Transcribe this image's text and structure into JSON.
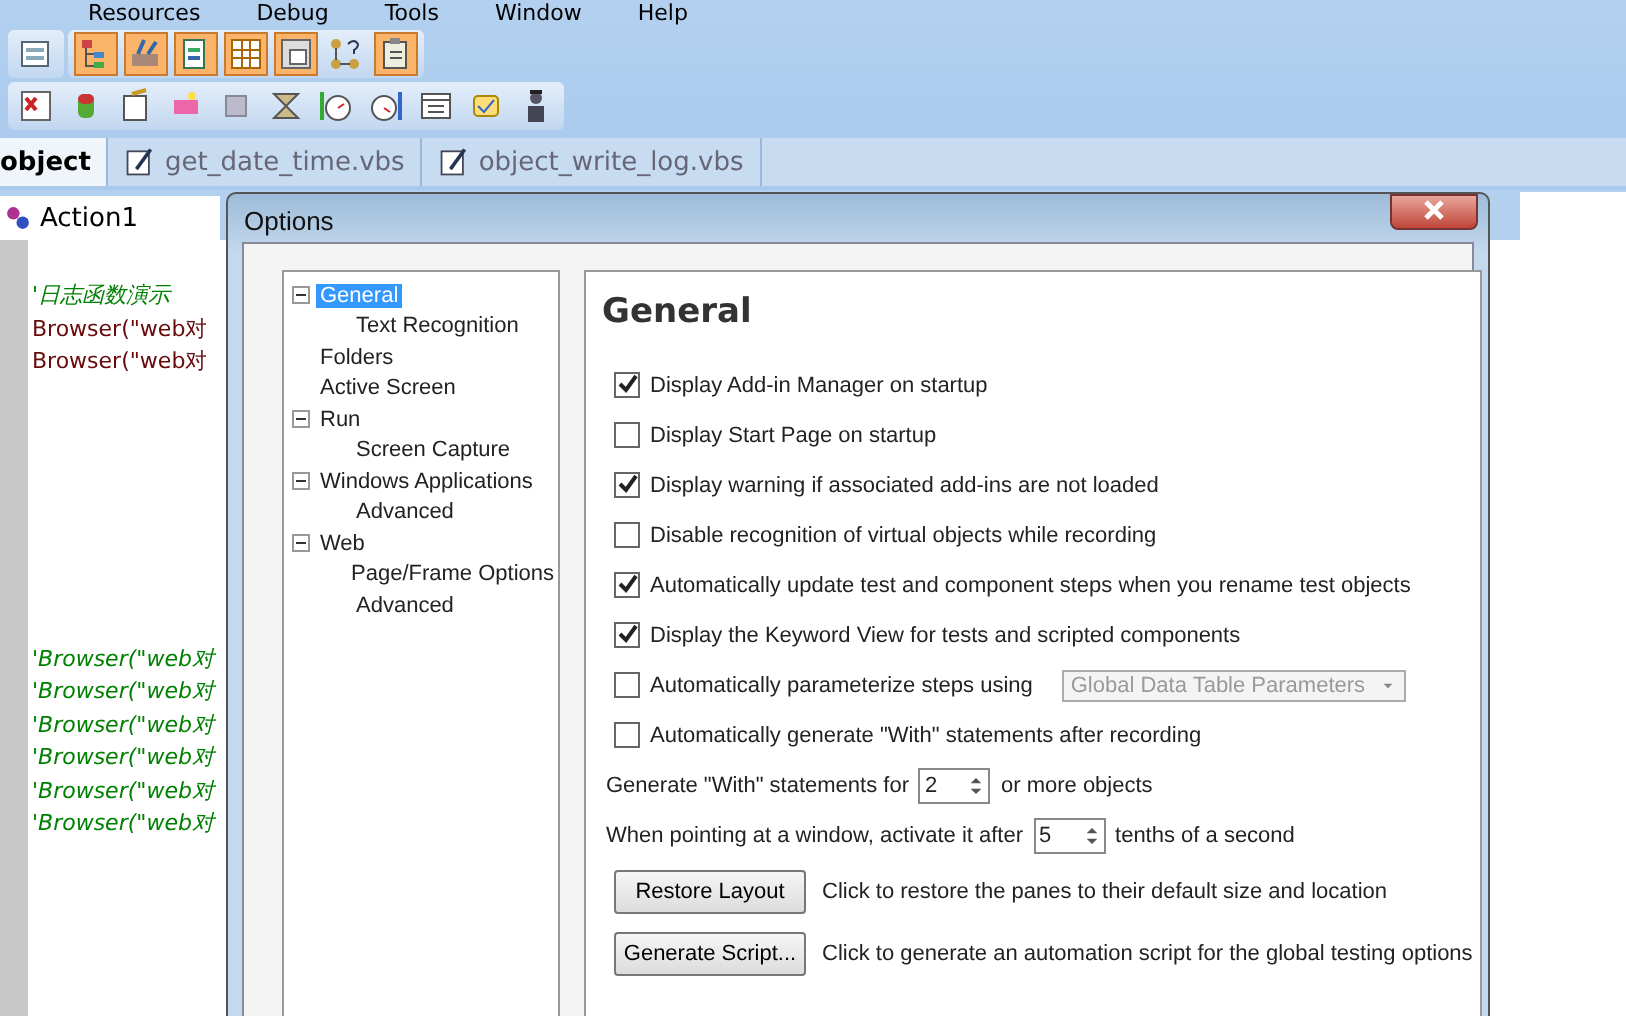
{
  "menu": [
    "Resources",
    "Debug",
    "Tools",
    "Window",
    "Help"
  ],
  "toolbar_1": [
    {
      "on": false
    },
    {
      "on": true
    },
    {
      "on": true
    },
    {
      "on": true
    },
    {
      "on": true
    },
    {
      "on": true
    },
    {
      "on": false
    },
    {
      "on": true
    }
  ],
  "doc_tabs": [
    {
      "label": "object",
      "selected": true
    },
    {
      "label": "get_date_time.vbs",
      "selected": false
    },
    {
      "label": "object_write_log.vbs",
      "selected": false
    }
  ],
  "editor": {
    "tab": "Action1",
    "lines": [
      {
        "kind": "comment",
        "text": "'日志函数演示"
      },
      {
        "kind": "code",
        "text": "Browser(\"web对"
      },
      {
        "kind": "code",
        "text": "Browser(\"web对"
      },
      {
        "kind": "blank"
      },
      {
        "kind": "blank"
      },
      {
        "kind": "blank"
      },
      {
        "kind": "blank"
      },
      {
        "kind": "blank"
      },
      {
        "kind": "blank"
      },
      {
        "kind": "blank"
      },
      {
        "kind": "blank"
      },
      {
        "kind": "comment",
        "text": "'Browser(\"web对"
      },
      {
        "kind": "comment",
        "text": "'Browser(\"web对"
      },
      {
        "kind": "comment",
        "text": "'Browser(\"web对"
      },
      {
        "kind": "comment",
        "text": "'Browser(\"web对"
      },
      {
        "kind": "comment",
        "text": "'Browser(\"web对"
      },
      {
        "kind": "comment",
        "text": "'Browser(\"web对"
      }
    ]
  },
  "dialog": {
    "title": "Options",
    "tree": [
      {
        "label": "General",
        "selected": true,
        "expanded": true,
        "children": [
          {
            "label": "Text Recognition",
            "selected": false
          }
        ]
      },
      {
        "label": "Folders",
        "selected": false
      },
      {
        "label": "Active Screen",
        "selected": false
      },
      {
        "label": "Run",
        "selected": false,
        "expanded": true,
        "children": [
          {
            "label": "Screen Capture",
            "selected": false
          }
        ]
      },
      {
        "label": "Windows Applications",
        "selected": false,
        "expanded": true,
        "children": [
          {
            "label": "Advanced",
            "selected": false
          }
        ]
      },
      {
        "label": "Web",
        "selected": false,
        "expanded": true,
        "children": [
          {
            "label": "Page/Frame Options",
            "selected": false
          },
          {
            "label": "Advanced",
            "selected": false
          }
        ]
      }
    ],
    "heading": "General",
    "options": [
      {
        "kind": "checkbox",
        "label": "Display Add-in Manager on startup",
        "checked": true
      },
      {
        "kind": "checkbox",
        "label": "Display Start Page on startup",
        "checked": false
      },
      {
        "kind": "checkbox",
        "label": "Display warning if associated add-ins are not loaded",
        "checked": true
      },
      {
        "kind": "checkbox",
        "label": "Disable recognition of virtual objects while recording",
        "checked": false
      },
      {
        "kind": "checkbox",
        "label": "Automatically update test and component steps when you rename test objects",
        "checked": true
      },
      {
        "kind": "checkbox",
        "label": "Display the Keyword View for tests and scripted components",
        "checked": true
      },
      {
        "kind": "checkbox_dropdown",
        "label": "Automatically parameterize steps using",
        "checked": false,
        "dropdown": "Global Data Table Parameters",
        "disabled": true
      },
      {
        "kind": "checkbox",
        "label": "Automatically generate \"With\" statements after recording",
        "checked": false
      },
      {
        "kind": "spin",
        "before": "Generate \"With\" statements for",
        "value": "2",
        "after": "or more objects"
      },
      {
        "kind": "spin",
        "before": "When pointing at a window, activate it after",
        "value": "5",
        "after": "tenths of a second"
      },
      {
        "kind": "button",
        "label": "Restore Layout",
        "description": "Click to restore the panes to their default size and location"
      },
      {
        "kind": "button",
        "label": "Generate Script...",
        "description": "Click to generate an automation script for the global testing options"
      }
    ]
  }
}
